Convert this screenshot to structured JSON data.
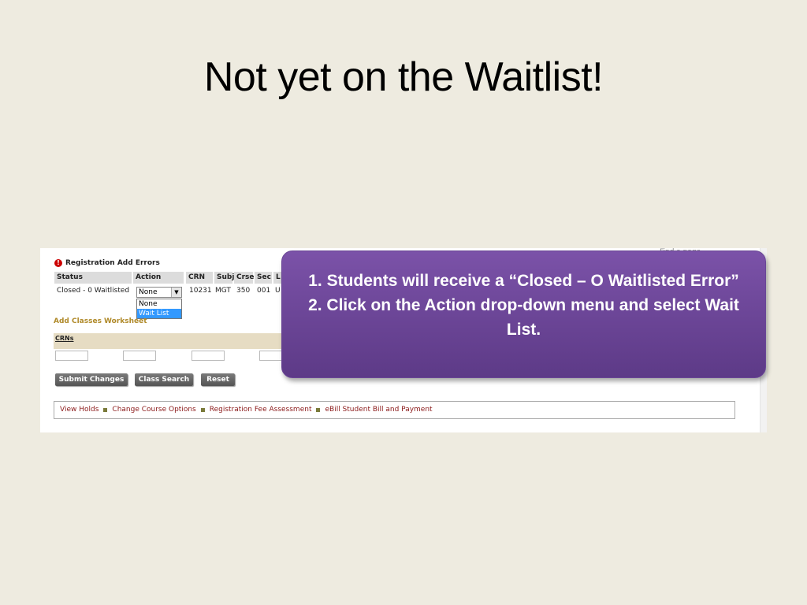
{
  "slide": {
    "title": "Not yet on the Waitlist!"
  },
  "screenshot": {
    "find_page": "Find a page",
    "error_heading": "Registration Add Errors",
    "columns": [
      "Status",
      "Action",
      "CRN",
      "Subj",
      "Crse",
      "Sec",
      "L"
    ],
    "row": {
      "status": "Closed - 0 Waitlisted",
      "action": "None",
      "crn": "10231",
      "subj": "MGT",
      "crse": "350",
      "sec": "001",
      "l": "U"
    },
    "dropdown_options": [
      "None",
      "Wait List"
    ],
    "selected_option": "Wait List",
    "worksheet_title": "Add Classes Worksheet",
    "crns_label": "CRNs",
    "buttons": {
      "submit": "Submit Changes",
      "class_search": "Class Search",
      "reset": "Reset"
    },
    "links": [
      "View Holds",
      "Change Course Options",
      "Registration Fee Assessment",
      "eBill Student Bill and Payment"
    ]
  },
  "callout": {
    "items": [
      "1.   Students will receive a “Closed – O Waitlisted Error”",
      "2.   Click on the Action drop-down menu and select Wait List."
    ]
  },
  "colors": {
    "background": "#eeebe0",
    "callout": "#6b479a",
    "error_icon": "#cc0000",
    "selected_option": "#3399ff"
  }
}
